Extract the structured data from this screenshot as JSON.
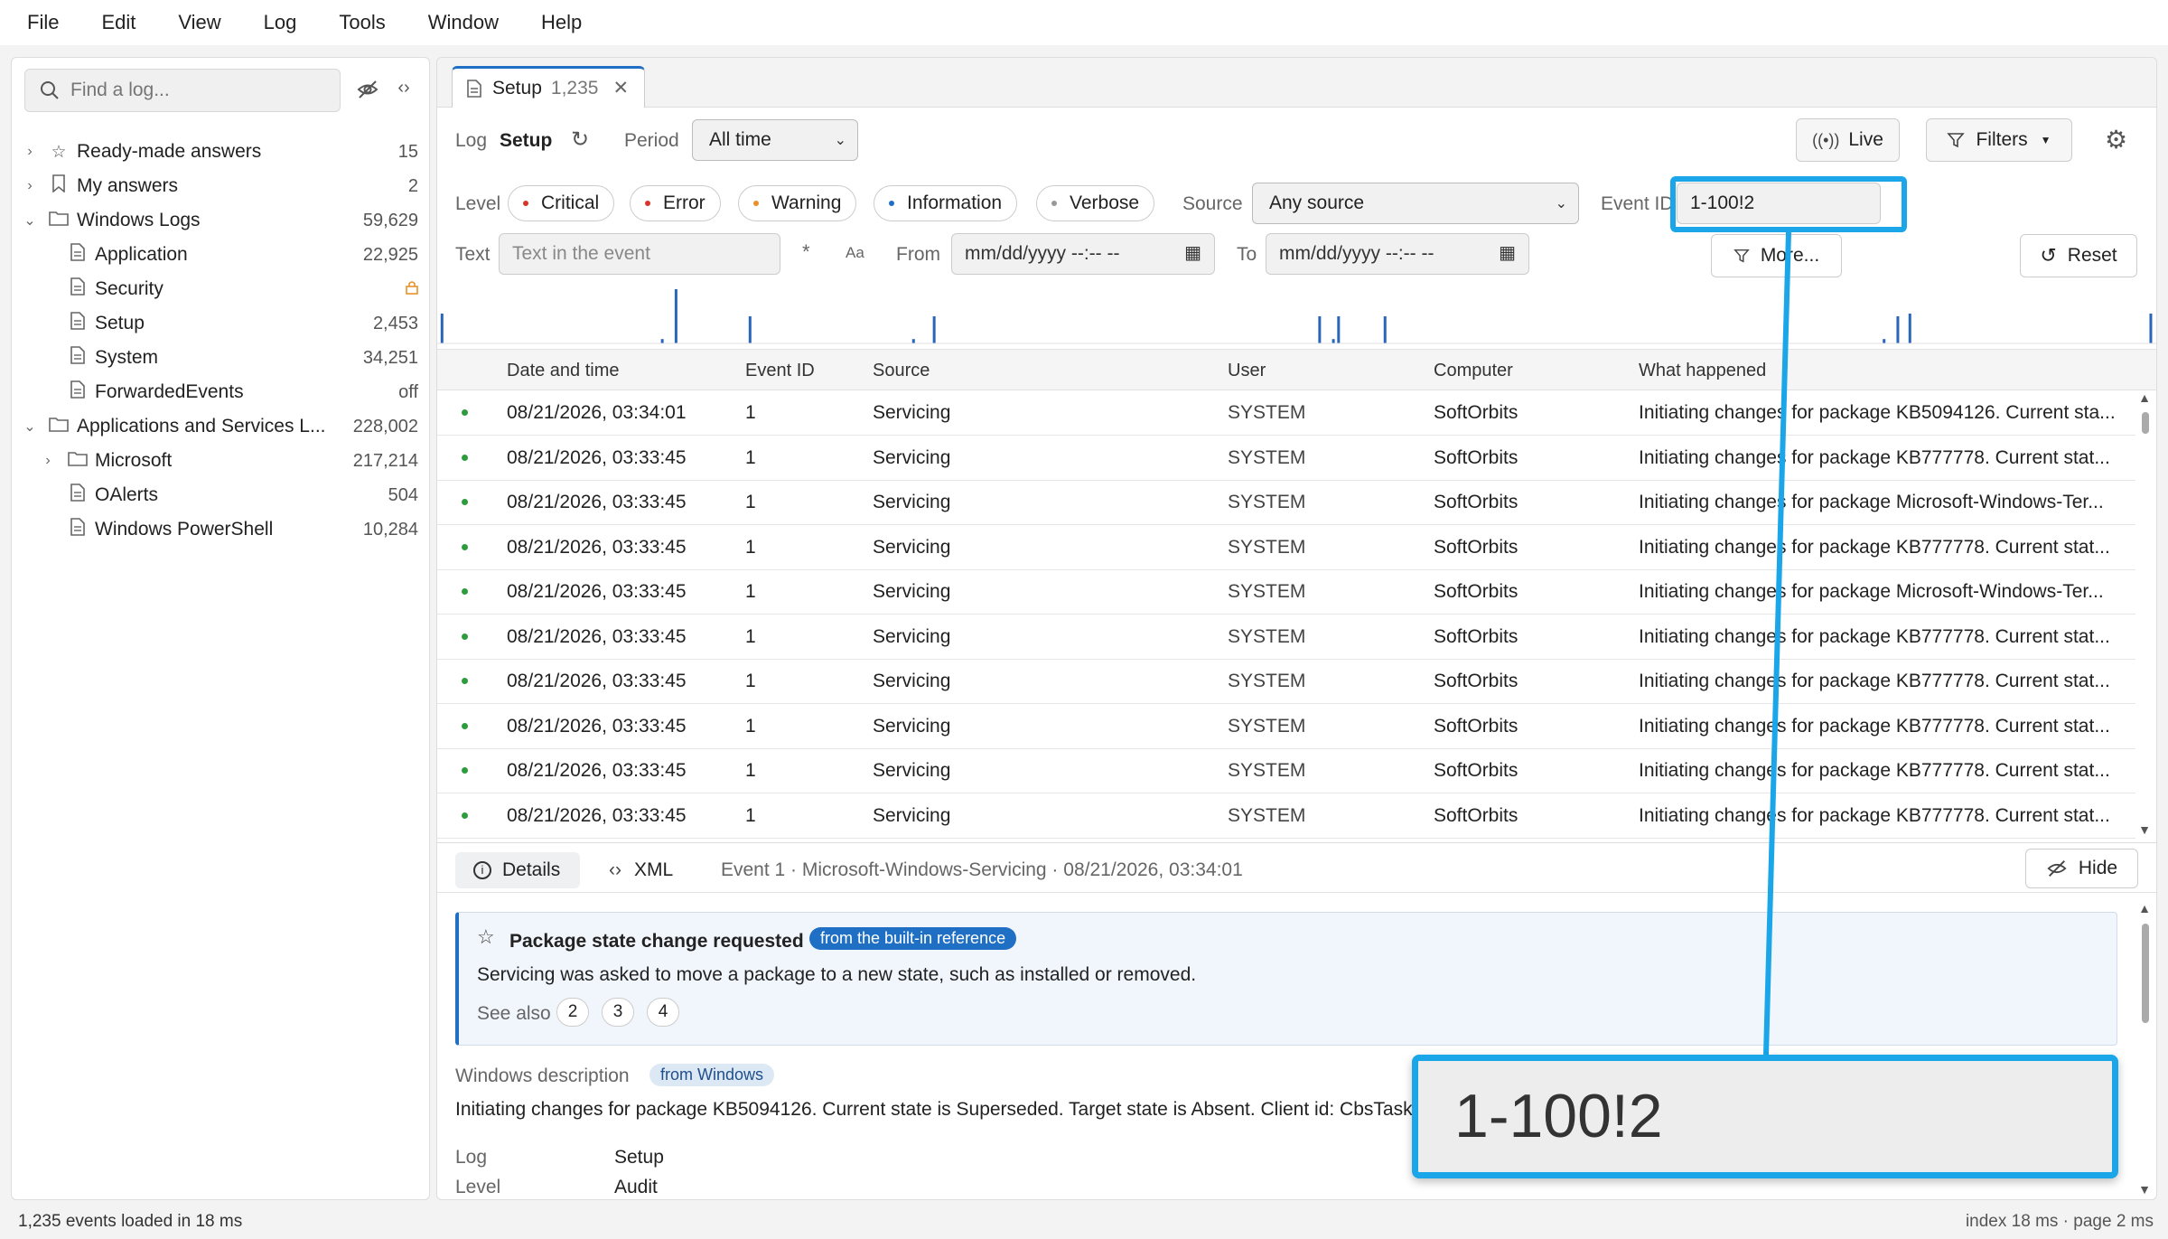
{
  "menu": [
    "File",
    "Edit",
    "View",
    "Log",
    "Tools",
    "Window",
    "Help"
  ],
  "sidebar": {
    "search_placeholder": "Find a log...",
    "tree": [
      {
        "label": "Ready-made answers",
        "count": "15",
        "icon": "star-icon",
        "level": 0,
        "expander": "collapsed"
      },
      {
        "label": "My answers",
        "count": "2",
        "icon": "bookmark-icon",
        "level": 0,
        "expander": "collapsed"
      },
      {
        "label": "Windows Logs",
        "count": "59,629",
        "icon": "folder-icon",
        "level": 0,
        "expander": "expanded"
      },
      {
        "label": "Application",
        "count": "22,925",
        "icon": "document-icon",
        "level": 1
      },
      {
        "label": "Security",
        "count": "",
        "icon": "document-icon",
        "level": 1,
        "count_icon": "lock-icon"
      },
      {
        "label": "Setup",
        "count": "2,453",
        "icon": "document-icon",
        "level": 1
      },
      {
        "label": "System",
        "count": "34,251",
        "icon": "document-icon",
        "level": 1
      },
      {
        "label": "ForwardedEvents",
        "count": "off",
        "icon": "document-icon",
        "level": 1
      },
      {
        "label": "Applications and Services L...",
        "count": "228,002",
        "icon": "folder-icon",
        "level": 0,
        "expander": "expanded"
      },
      {
        "label": "Microsoft",
        "count": "217,214",
        "icon": "folder-icon",
        "level": 1,
        "expander": "collapsed"
      },
      {
        "label": "OAlerts",
        "count": "504",
        "icon": "document-icon",
        "level": 1
      },
      {
        "label": "Windows PowerShell",
        "count": "10,284",
        "icon": "document-icon",
        "level": 1
      }
    ]
  },
  "tab": {
    "label": "Setup",
    "count": "1,235"
  },
  "toolbar": {
    "log_label": "Log",
    "log_value": "Setup",
    "period_label": "Period",
    "period_value": "All time",
    "live_label": "Live",
    "filters_label": "Filters"
  },
  "filters": {
    "level_label": "Level",
    "levels": [
      {
        "label": "Critical",
        "color": "#d9342b"
      },
      {
        "label": "Error",
        "color": "#d9342b"
      },
      {
        "label": "Warning",
        "color": "#e8912a"
      },
      {
        "label": "Information",
        "color": "#1f6fc5"
      },
      {
        "label": "Verbose",
        "color": "#999999"
      }
    ],
    "source_label": "Source",
    "source_value": "Any source",
    "eventid_label": "Event ID",
    "eventid_value": "1-100!2",
    "text_label": "Text",
    "text_placeholder": "Text in the event",
    "regex_icon": "*",
    "case_icon": "Aa",
    "from_label": "From",
    "from_value": "mm/dd/yyyy --:-- --",
    "to_label": "To",
    "to_value": "mm/dd/yyyy --:-- --",
    "more_label": "More...",
    "reset_label": "Reset"
  },
  "histogram_bars": [
    {
      "x": 0.002,
      "h": 0.55
    },
    {
      "x": 0.13,
      "h": 0.08
    },
    {
      "x": 0.138,
      "h": 1.0
    },
    {
      "x": 0.181,
      "h": 0.5
    },
    {
      "x": 0.276,
      "h": 0.08
    },
    {
      "x": 0.288,
      "h": 0.5
    },
    {
      "x": 0.512,
      "h": 0.5
    },
    {
      "x": 0.52,
      "h": 0.08
    },
    {
      "x": 0.523,
      "h": 0.5
    },
    {
      "x": 0.55,
      "h": 0.5
    },
    {
      "x": 0.84,
      "h": 0.08
    },
    {
      "x": 0.848,
      "h": 0.5
    },
    {
      "x": 0.855,
      "h": 0.55
    },
    {
      "x": 0.995,
      "h": 0.55
    }
  ],
  "table": {
    "columns": [
      "Date and time",
      "Event ID",
      "Source",
      "User",
      "Computer",
      "What happened"
    ],
    "rows": [
      [
        "08/21/2026, 03:34:01",
        "1",
        "Servicing",
        "SYSTEM",
        "SoftOrbits",
        "Initiating changes for package KB5094126. Current sta..."
      ],
      [
        "08/21/2026, 03:33:45",
        "1",
        "Servicing",
        "SYSTEM",
        "SoftOrbits",
        "Initiating changes for package KB777778. Current stat..."
      ],
      [
        "08/21/2026, 03:33:45",
        "1",
        "Servicing",
        "SYSTEM",
        "SoftOrbits",
        "Initiating changes for package Microsoft-Windows-Ter..."
      ],
      [
        "08/21/2026, 03:33:45",
        "1",
        "Servicing",
        "SYSTEM",
        "SoftOrbits",
        "Initiating changes for package KB777778. Current stat..."
      ],
      [
        "08/21/2026, 03:33:45",
        "1",
        "Servicing",
        "SYSTEM",
        "SoftOrbits",
        "Initiating changes for package Microsoft-Windows-Ter..."
      ],
      [
        "08/21/2026, 03:33:45",
        "1",
        "Servicing",
        "SYSTEM",
        "SoftOrbits",
        "Initiating changes for package KB777778. Current stat..."
      ],
      [
        "08/21/2026, 03:33:45",
        "1",
        "Servicing",
        "SYSTEM",
        "SoftOrbits",
        "Initiating changes for package KB777778. Current stat..."
      ],
      [
        "08/21/2026, 03:33:45",
        "1",
        "Servicing",
        "SYSTEM",
        "SoftOrbits",
        "Initiating changes for package KB777778. Current stat..."
      ],
      [
        "08/21/2026, 03:33:45",
        "1",
        "Servicing",
        "SYSTEM",
        "SoftOrbits",
        "Initiating changes for package KB777778. Current stat..."
      ],
      [
        "08/21/2026, 03:33:45",
        "1",
        "Servicing",
        "SYSTEM",
        "SoftOrbits",
        "Initiating changes for package KB777778. Current stat..."
      ]
    ]
  },
  "details": {
    "tab_details": "Details",
    "tab_xml": "XML",
    "summary": "Event 1 · Microsoft-Windows-Servicing · 08/21/2026, 03:34:01",
    "hide_label": "Hide",
    "card_title": "Package state change requested",
    "card_badge": "from the built-in reference",
    "card_text": "Servicing was asked to move a package to a new state, such as installed or removed.",
    "see_also_label": "See also",
    "see_also": [
      "2",
      "3",
      "4"
    ],
    "win_desc_label": "Windows description",
    "win_desc_badge": "from Windows",
    "win_desc_text": "Initiating changes for package KB5094126. Current state is Superseded. Target state is Absent. Client id: CbsTask.",
    "fields": [
      {
        "label": "Log",
        "value": "Setup"
      },
      {
        "label": "Level",
        "value": "Audit"
      }
    ]
  },
  "zoom_text": "1-100!2",
  "status": {
    "left": "1,235 events loaded in 18 ms",
    "right": "index 18 ms · page 2 ms"
  },
  "colors": {
    "accent": "#1f6fc5",
    "highlight": "#1aa6e8",
    "info_green": "#2e9b3c"
  }
}
